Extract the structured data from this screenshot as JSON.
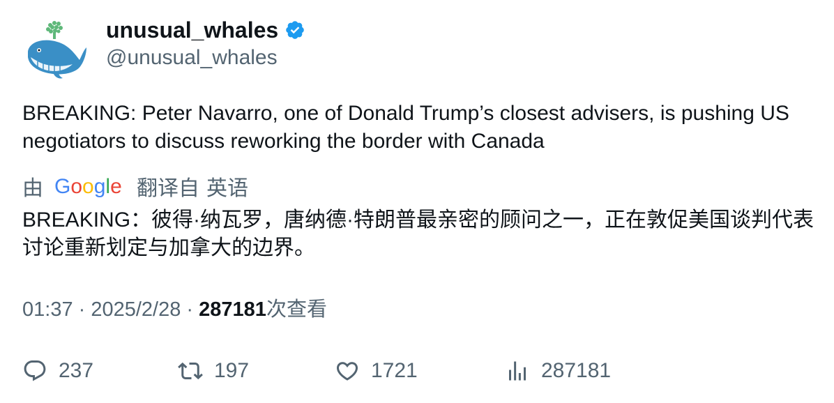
{
  "author": {
    "display_name": "unusual_whales",
    "handle": "@unusual_whales",
    "verified": true
  },
  "tweet": {
    "text": "BREAKING: Peter Navarro, one of Donald Trump’s closest advisers, is pushing US negotiators to discuss reworking the border with Canada"
  },
  "translation": {
    "by_label": "由",
    "provider": "Google",
    "translated_from_label": "翻译自",
    "source_language": "英语",
    "text": "BREAKING：彼得·纳瓦罗，唐纳德·特朗普最亲密的顾问之一，正在敦促美国谈判代表讨论重新划定与加拿大的边界。"
  },
  "meta": {
    "time": "01:37",
    "separator": " · ",
    "date": "2025/2/28",
    "views_count": "287181",
    "views_label": "次查看"
  },
  "actions": {
    "replies": "237",
    "retweets": "197",
    "likes": "1721",
    "views": "287181"
  },
  "colors": {
    "text_primary": "#0f1419",
    "text_secondary": "#536471",
    "verified_blue": "#1d9bf0"
  },
  "icons": [
    "whale-avatar",
    "verified-badge-icon",
    "google-logo",
    "reply-icon",
    "retweet-icon",
    "like-icon",
    "views-icon"
  ]
}
